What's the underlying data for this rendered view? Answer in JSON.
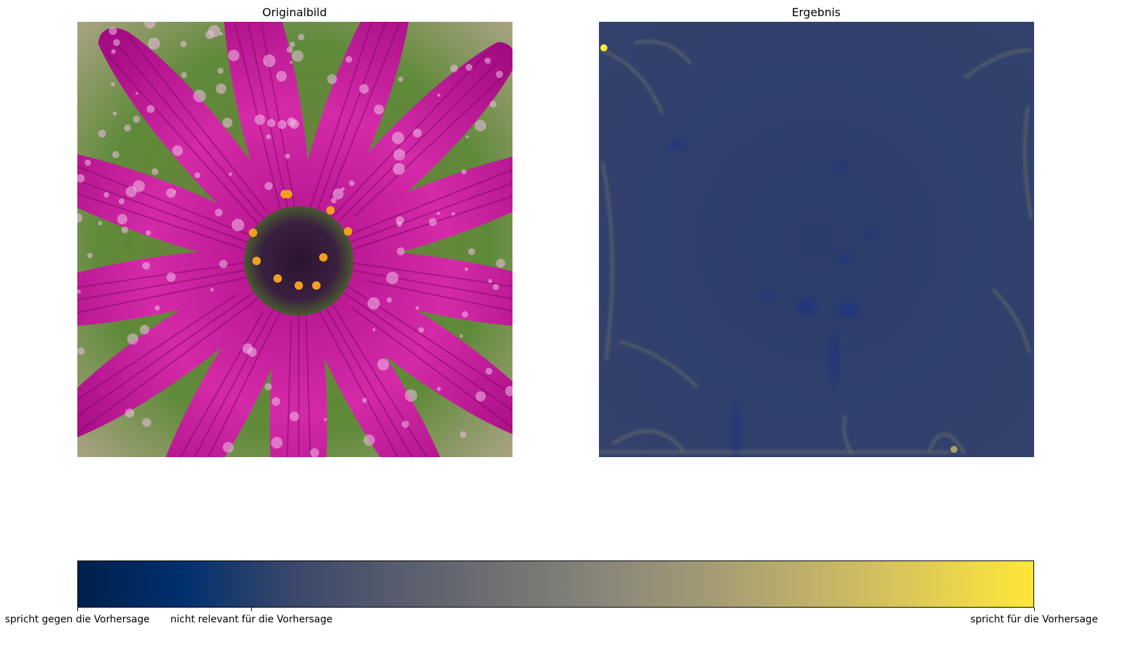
{
  "chart_data": [
    {
      "type": "image",
      "title": "Originalbild",
      "content_icon": "purple-flower-photo-icon"
    },
    {
      "type": "heatmap",
      "title": "Ergebnis",
      "colormap": "cividis",
      "colorbar": {
        "orientation": "horizontal",
        "colors": [
          "#00204c",
          "#00306f",
          "#39476b",
          "#575c6d",
          "#707173",
          "#8a8779",
          "#a59c74",
          "#c3b369",
          "#e1cc55",
          "#fee838"
        ],
        "ticks": [
          {
            "position": 0.0,
            "label": "spricht gegen die Vorhersage"
          },
          {
            "position": 0.182,
            "label": "nicht relevant für die Vorhersage"
          },
          {
            "position": 1.0,
            "label": "spricht für die Vorhersage"
          }
        ]
      }
    }
  ]
}
